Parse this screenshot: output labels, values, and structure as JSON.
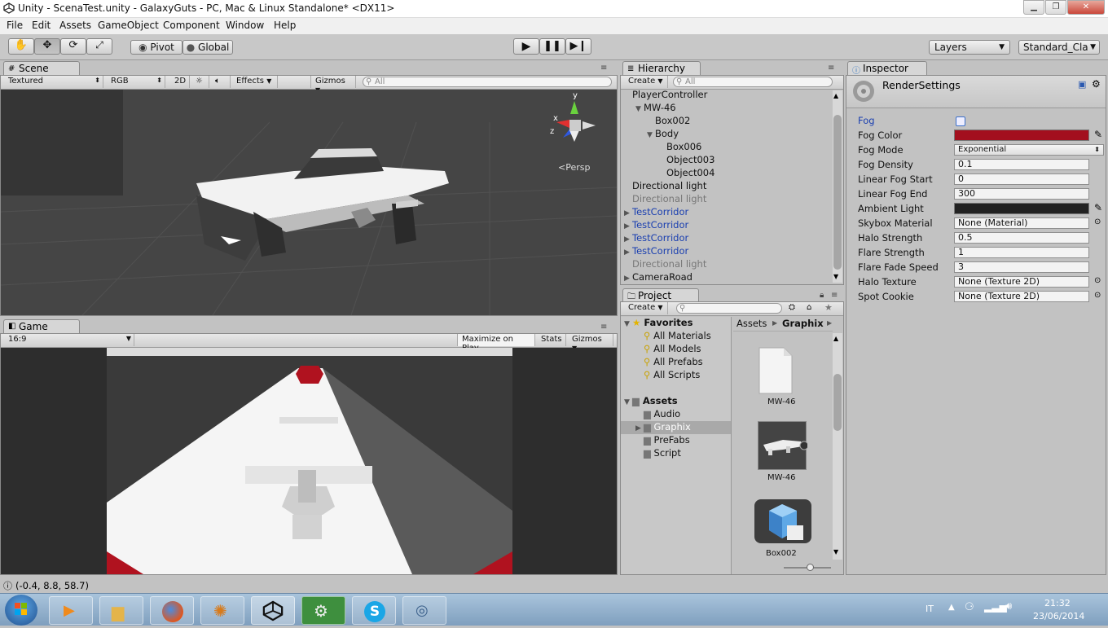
{
  "window": {
    "title": "Unity - ScenaTest.unity - GalaxyGuts - PC, Mac & Linux Standalone* <DX11>"
  },
  "menu": [
    "File",
    "Edit",
    "Assets",
    "GameObject",
    "Component",
    "Window",
    "Help"
  ],
  "toolbar": {
    "pivot": "Pivot",
    "global": "Global",
    "layers": "Layers",
    "layout": "Standard_Cla"
  },
  "scene": {
    "tab": "Scene",
    "shading": "Textured",
    "render": "RGB",
    "mode2d": "2D",
    "effects": "Effects",
    "gizmos": "Gizmos",
    "search": "All",
    "persp": "Persp",
    "axis_y": "y",
    "axis_x": "x",
    "axis_z": "z"
  },
  "game": {
    "tab": "Game",
    "aspect": "16:9",
    "maximize": "Maximize on Play",
    "stats": "Stats",
    "gizmos": "Gizmos"
  },
  "hierarchy": {
    "tab": "Hierarchy",
    "create": "Create",
    "search": "All",
    "items": [
      {
        "label": "PlayerController",
        "indent": 0,
        "arrow": "",
        "style": ""
      },
      {
        "label": "MW-46",
        "indent": 1,
        "arrow": "▼",
        "style": ""
      },
      {
        "label": "Box002",
        "indent": 2,
        "arrow": "",
        "style": ""
      },
      {
        "label": "Body",
        "indent": 2,
        "arrow": "▼",
        "style": ""
      },
      {
        "label": "Box006",
        "indent": 3,
        "arrow": "",
        "style": ""
      },
      {
        "label": "Object003",
        "indent": 3,
        "arrow": "",
        "style": ""
      },
      {
        "label": "Object004",
        "indent": 3,
        "arrow": "",
        "style": ""
      },
      {
        "label": "Directional light",
        "indent": 0,
        "arrow": "",
        "style": ""
      },
      {
        "label": "Directional light",
        "indent": 0,
        "arrow": "",
        "style": "gray"
      },
      {
        "label": "TestCorridor",
        "indent": 0,
        "arrow": "▶",
        "style": "blue"
      },
      {
        "label": "TestCorridor",
        "indent": 0,
        "arrow": "▶",
        "style": "blue"
      },
      {
        "label": "TestCorridor",
        "indent": 0,
        "arrow": "▶",
        "style": "blue"
      },
      {
        "label": "TestCorridor",
        "indent": 0,
        "arrow": "▶",
        "style": "blue"
      },
      {
        "label": "Directional light",
        "indent": 0,
        "arrow": "",
        "style": "gray"
      },
      {
        "label": "CameraRoad",
        "indent": 0,
        "arrow": "▶",
        "style": ""
      }
    ]
  },
  "project": {
    "tab": "Project",
    "create": "Create",
    "favorites": "Favorites",
    "fav_items": [
      "All Materials",
      "All Models",
      "All Prefabs",
      "All Scripts"
    ],
    "assets": "Assets",
    "asset_folders": [
      "Audio",
      "Graphix",
      "PreFabs",
      "Script"
    ],
    "breadcrumb_root": "Assets",
    "breadcrumb_current": "Graphix",
    "thumbs": [
      "MW-46",
      "MW-46",
      "Box002"
    ]
  },
  "inspector": {
    "tab": "Inspector",
    "object": "RenderSettings",
    "props": [
      {
        "label": "Fog",
        "value": "",
        "kind": "checkbox"
      },
      {
        "label": "Fog Color",
        "value": "",
        "kind": "color",
        "color": "#a30f1e"
      },
      {
        "label": "Fog Mode",
        "value": "Exponential",
        "kind": "dropdown"
      },
      {
        "label": "Fog Density",
        "value": "0.1",
        "kind": "text"
      },
      {
        "label": "Linear Fog Start",
        "value": "0",
        "kind": "text"
      },
      {
        "label": "Linear Fog End",
        "value": "300",
        "kind": "text"
      },
      {
        "label": "Ambient Light",
        "value": "",
        "kind": "color",
        "color": "#222222"
      },
      {
        "label": "Skybox Material",
        "value": "None (Material)",
        "kind": "object"
      },
      {
        "label": "Halo Strength",
        "value": "0.5",
        "kind": "text"
      },
      {
        "label": "Flare Strength",
        "value": "1",
        "kind": "text"
      },
      {
        "label": "Flare Fade Speed",
        "value": "3",
        "kind": "text"
      },
      {
        "label": "Halo Texture",
        "value": "None (Texture 2D)",
        "kind": "object"
      },
      {
        "label": "Spot Cookie",
        "value": "None (Texture 2D)",
        "kind": "object"
      }
    ]
  },
  "status": {
    "text": "(-0.4, 8.8, 58.7)"
  },
  "taskbar": {
    "lang": "IT",
    "time": "21:32",
    "date": "23/06/2014"
  }
}
